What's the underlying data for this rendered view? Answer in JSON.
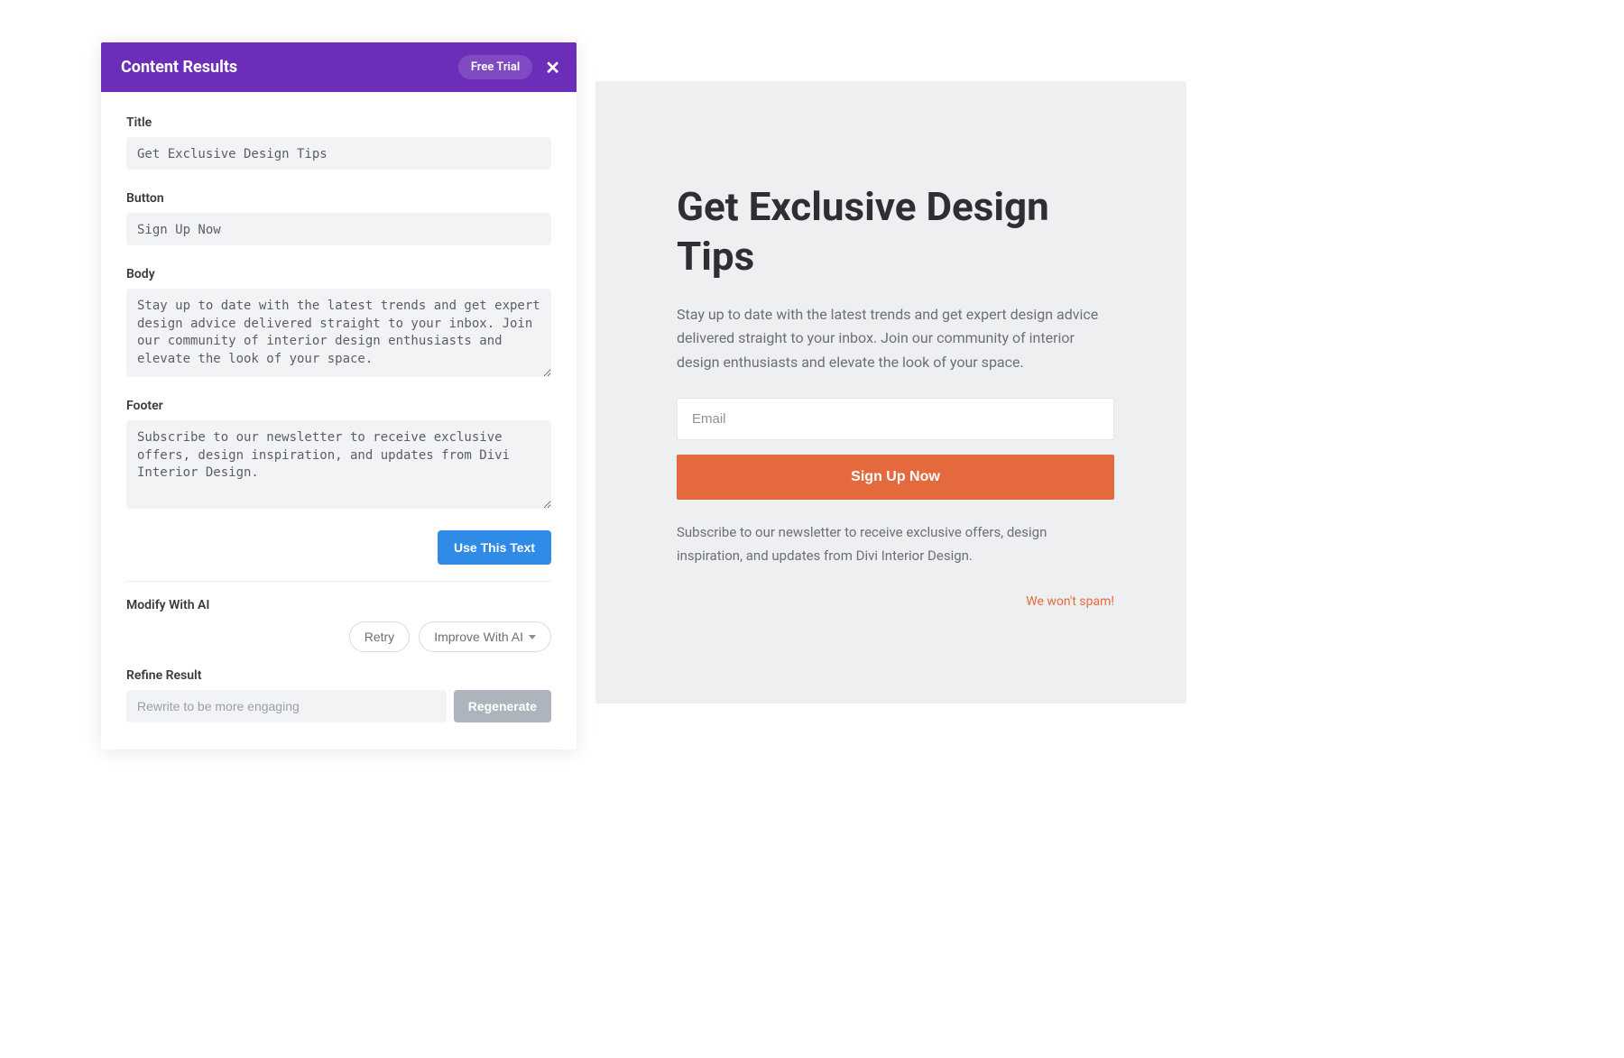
{
  "panel": {
    "header_title": "Content Results",
    "free_trial_label": "Free Trial",
    "labels": {
      "title": "Title",
      "button": "Button",
      "body": "Body",
      "footer": "Footer",
      "modify": "Modify With AI",
      "refine": "Refine Result"
    },
    "values": {
      "title": "Get Exclusive Design Tips",
      "button": "Sign Up Now",
      "body": "Stay up to date with the latest trends and get expert design advice delivered straight to your inbox. Join our community of interior design enthusiasts and elevate the look of your space.",
      "footer": "Subscribe to our newsletter to receive exclusive offers, design inspiration, and updates from Divi Interior Design."
    },
    "buttons": {
      "use_text": "Use This Text",
      "retry": "Retry",
      "improve": "Improve With AI",
      "regenerate": "Regenerate"
    },
    "refine_placeholder": "Rewrite to be more engaging"
  },
  "preview": {
    "title": "Get Exclusive Design Tips",
    "body": "Stay up to date with the latest trends and get expert design advice delivered straight to your inbox. Join our community of interior design enthusiasts and elevate the look of your space.",
    "email_placeholder": "Email",
    "signup_label": "Sign Up Now",
    "footer": "Subscribe to our newsletter to receive exclusive offers, design inspiration, and updates from Divi Interior Design.",
    "no_spam": "We won't spam!"
  }
}
